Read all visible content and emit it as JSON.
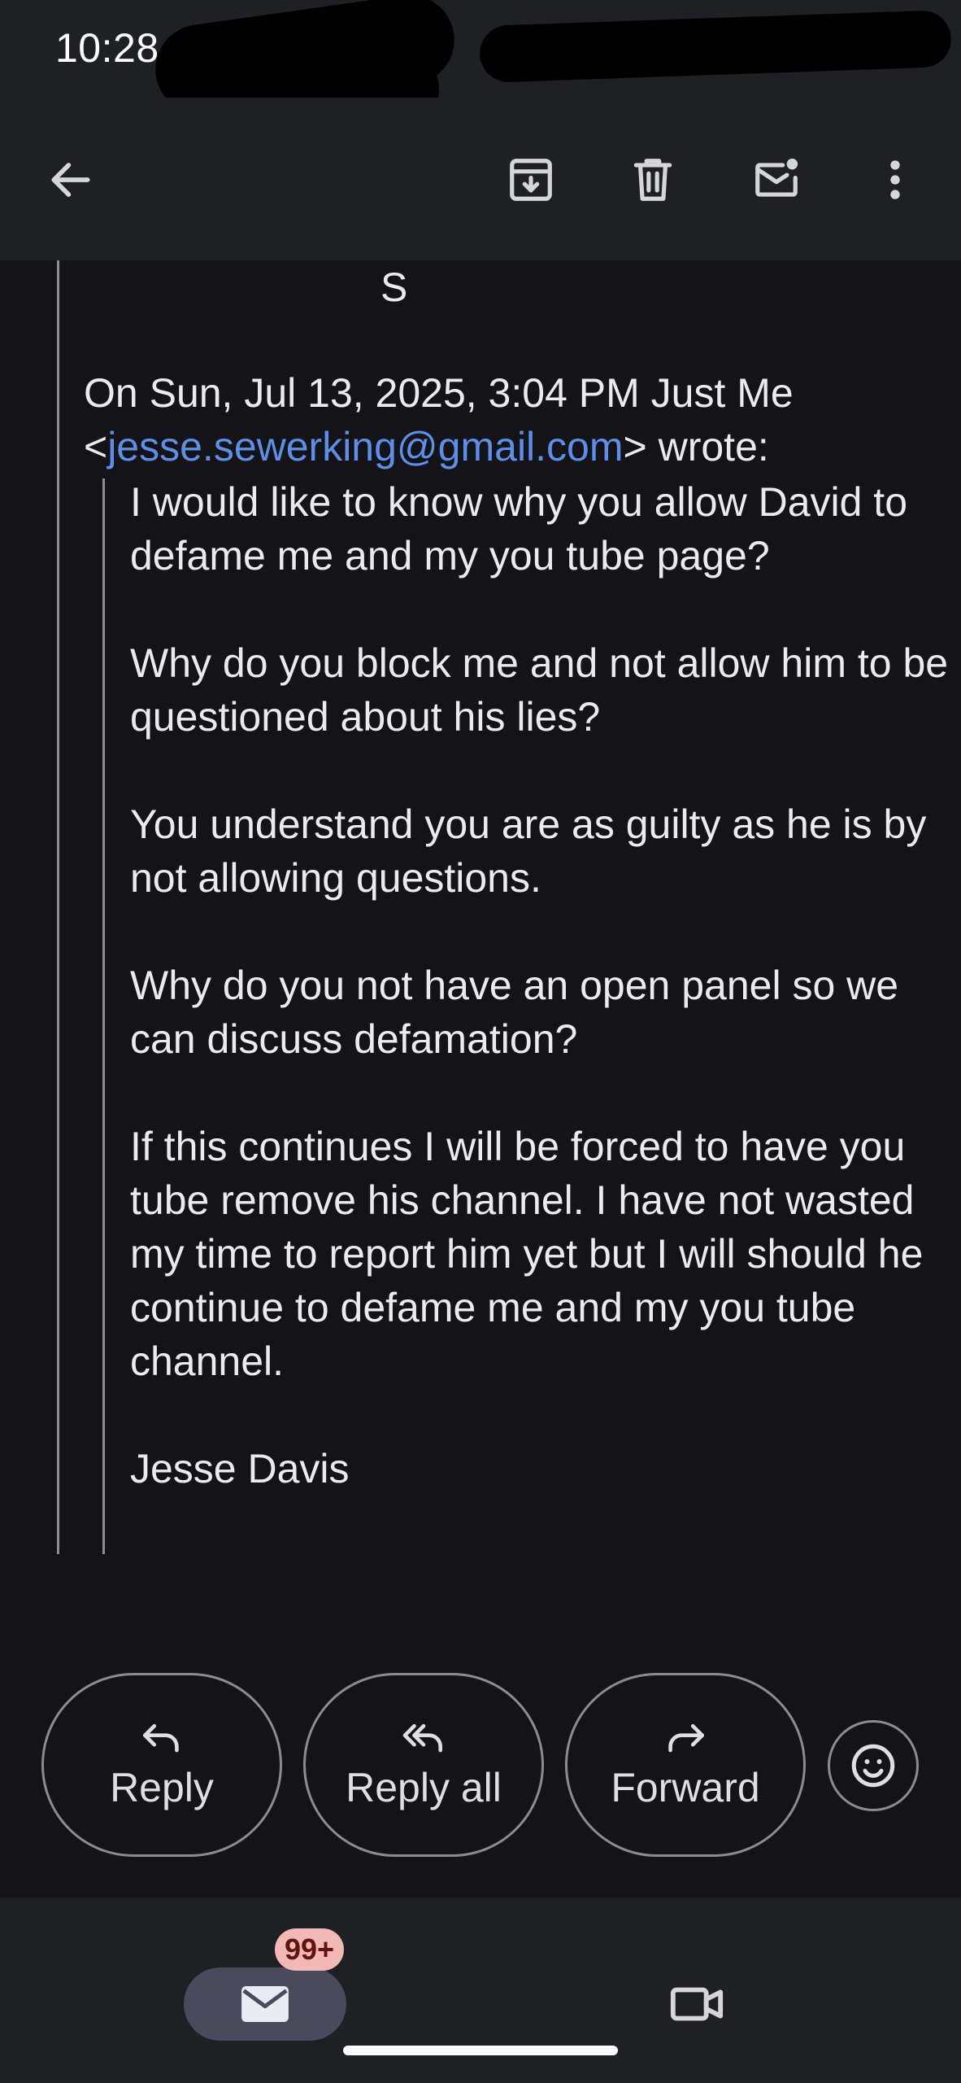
{
  "status_bar": {
    "time": "10:28"
  },
  "toolbar": {
    "back_icon": "arrow-left-icon",
    "archive_icon": "archive-icon",
    "delete_icon": "trash-icon",
    "mark_unread_icon": "mail-dot-icon",
    "more_icon": "more-vertical-icon"
  },
  "message": {
    "signature_initial": "S",
    "attribution_prefix": "On Sun, Jul 13, 2025, 3:04 PM Just Me <",
    "attribution_email": "jesse.sewerking@gmail.com",
    "attribution_suffix": "> wrote:",
    "quoted_paragraphs": [
      "I would like to know why you allow David to defame me and my you tube page?",
      "Why do you block me and not allow him to be questioned about his lies?",
      "You understand you are as guilty as he is by not allowing questions.",
      "Why do you not have an open panel so we can discuss defamation?",
      "If this continues I will be forced to have you tube remove his channel. I have not wasted my time to report him yet but I will should he continue to defame me and my you tube channel.",
      "Jesse Davis"
    ]
  },
  "actions": {
    "reply_label": "Reply",
    "reply_all_label": "Reply all",
    "forward_label": "Forward",
    "emoji_icon": "smiley-icon"
  },
  "bottom_nav": {
    "mail_badge": "99+",
    "mail_icon": "mail-icon",
    "meet_icon": "video-camera-icon"
  },
  "colors": {
    "background": "#141418",
    "bar": "#1f2024",
    "link": "#5b8fe8",
    "badge_bg": "#f2b8b5",
    "badge_text": "#601410",
    "active_tab": "#4a4a5c"
  }
}
